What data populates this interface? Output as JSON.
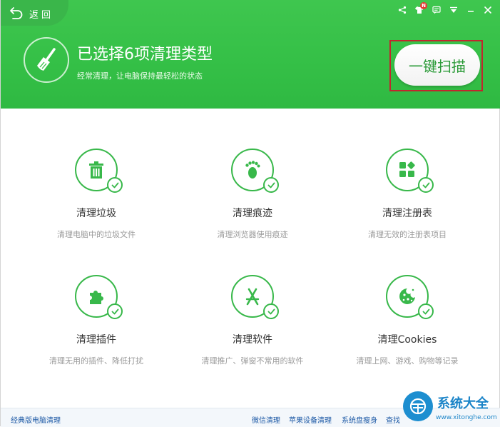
{
  "header": {
    "back_label": "返回",
    "headline": "已选择6项清理类型",
    "subline": "经常清理，让电脑保持最轻松的状态",
    "scan_button": "一键扫描",
    "notification_badge": "N"
  },
  "colors": {
    "brand_green": "#35c047",
    "accent_green": "#38b84a",
    "highlight_red": "#c0272d",
    "link_blue": "#1e5aa6"
  },
  "icons": {
    "back": "back-arrow-icon",
    "share": "share-icon",
    "notification": "shirt-notification-icon",
    "message": "message-icon",
    "menu": "menu-down-icon",
    "close": "close-icon"
  },
  "cards": [
    {
      "title": "清理垃圾",
      "desc": "清理电脑中的垃圾文件",
      "icon": "trash-icon"
    },
    {
      "title": "清理痕迹",
      "desc": "清理浏览器使用痕迹",
      "icon": "footprint-icon"
    },
    {
      "title": "清理注册表",
      "desc": "清理无效的注册表项目",
      "icon": "registry-icon"
    },
    {
      "title": "清理插件",
      "desc": "清理无用的插件、降低打扰",
      "icon": "puzzle-icon"
    },
    {
      "title": "清理软件",
      "desc": "清理推广、弹窗不常用的软件",
      "icon": "app-store-icon"
    },
    {
      "title": "清理Cookies",
      "desc": "清理上网、游戏、购物等记录",
      "icon": "cookie-icon"
    }
  ],
  "footer": {
    "classic_link": "经典版电脑清理",
    "wechat_link": "微信清理",
    "apple_link": "苹果设备清理",
    "slim_link": "系统盘瘦身",
    "query_link": "查找"
  },
  "watermark": {
    "title": "系统大全",
    "url": "www.xitonghe.com"
  }
}
